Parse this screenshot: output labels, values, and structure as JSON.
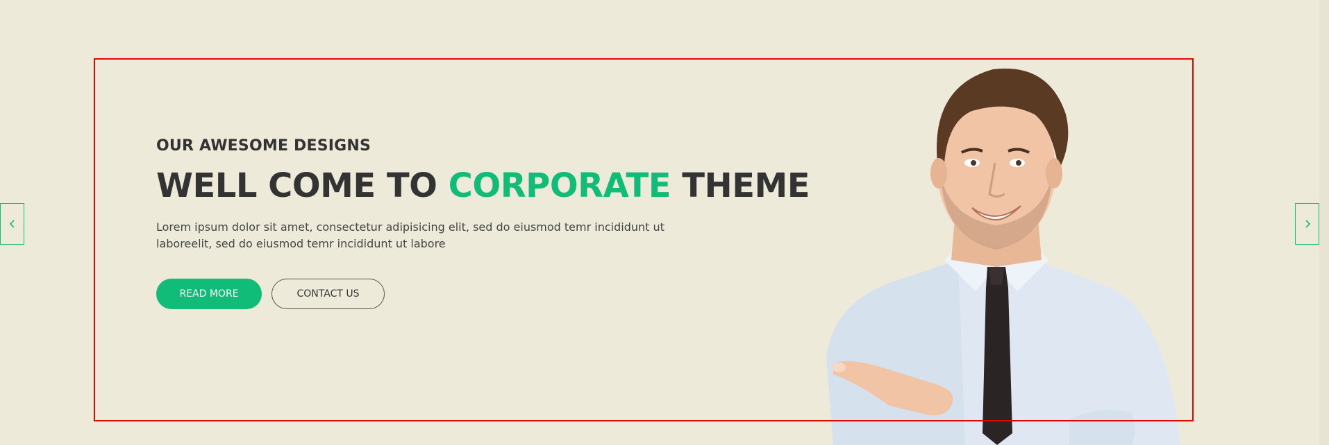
{
  "hero": {
    "eyebrow": "OUR AWESOME DESIGNS",
    "headline": {
      "part1": "WELL COME TO ",
      "accent": "CORPORATE",
      "part2": " THEME"
    },
    "body": "Lorem ipsum dolor sit amet, consectetur adipisicing elit, sed do eiusmod temr incididunt ut laboreelit, sed do eiusmod temr incididunt ut labore",
    "buttons": {
      "read_more": "READ MORE",
      "contact_us": "CONTACT US"
    }
  },
  "slider": {
    "prev_icon": "chevron-left-icon",
    "next_icon": "chevron-right-icon"
  },
  "colors": {
    "background": "#eeeada",
    "accent": "#11bb78",
    "text": "#333333",
    "frame": "#e10600"
  }
}
